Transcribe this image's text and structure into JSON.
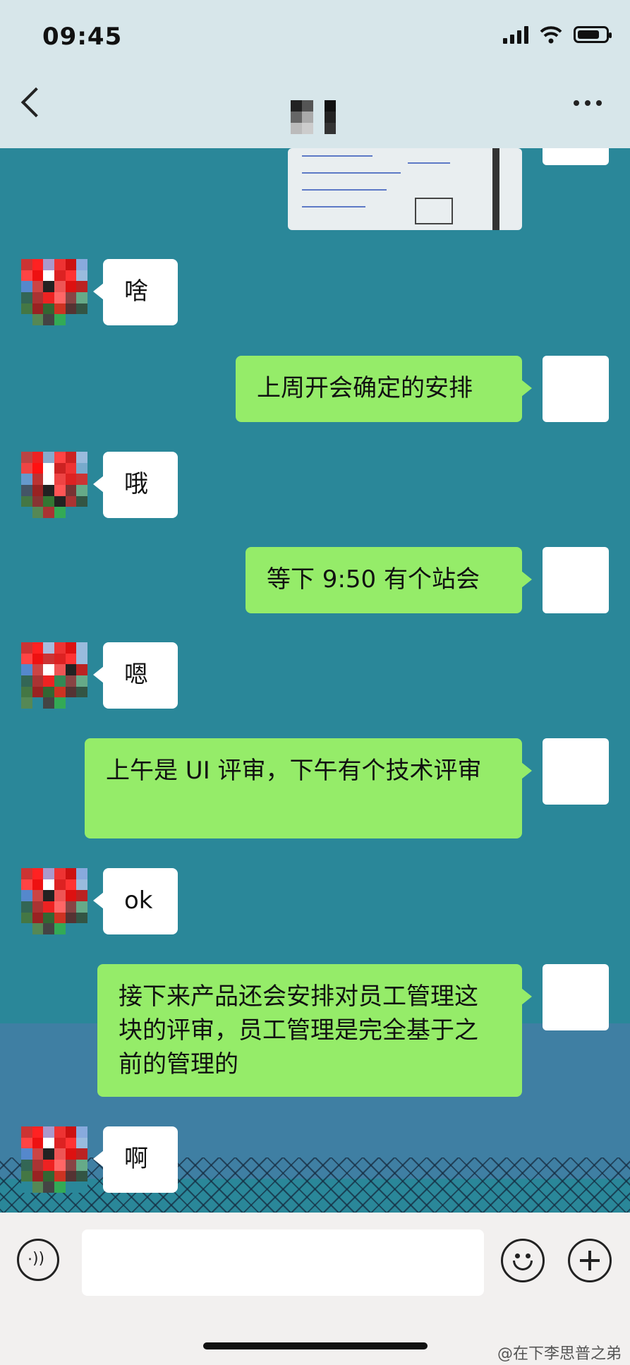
{
  "status_bar": {
    "time": "09:45"
  },
  "header": {
    "back_icon": "chevron-left-icon",
    "more_icon": "more-dots-icon"
  },
  "messages": [
    {
      "side": "in",
      "text": "啥"
    },
    {
      "side": "out",
      "text": "上周开会确定的安排"
    },
    {
      "side": "in",
      "text": "哦"
    },
    {
      "side": "out",
      "text": "等下 9:50 有个站会"
    },
    {
      "side": "in",
      "text": "嗯"
    },
    {
      "side": "out",
      "text": "上午是 UI 评审，下午有个技术评审"
    },
    {
      "side": "in",
      "text": "ok"
    },
    {
      "side": "out",
      "text": "接下来产品还会安排对员工管理这块的评审，员工管理是完全基于之前的管理的"
    },
    {
      "side": "in",
      "text": "啊"
    }
  ],
  "input_bar": {
    "placeholder": ""
  },
  "watermark": "@在下李思普之弟",
  "colors": {
    "sent_bubble": "#95ec69",
    "received_bubble": "#ffffff",
    "chat_bg": "#2a8799"
  }
}
